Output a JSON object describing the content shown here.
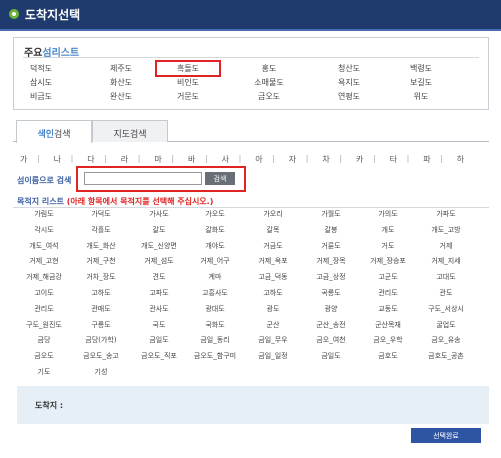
{
  "window": {
    "title": "도착지선택"
  },
  "major": {
    "title_prefix": "주요",
    "title_suffix": "섬리스트",
    "islands": [
      "덕적도",
      "제주도",
      "흑돌도",
      "홍도",
      "청산도",
      "백령도",
      "삼시도",
      "화산도",
      "비인도",
      "소매물도",
      "욕지도",
      "보길도",
      "비금도",
      "완산도",
      "거문도",
      "금오도",
      "연평도",
      "위도"
    ],
    "selected_index": 2
  },
  "tabs": [
    {
      "prefix": "색인",
      "suffix": "검색",
      "active": true
    },
    {
      "prefix": "",
      "suffix": "지도검색",
      "active": false
    }
  ],
  "alphabet": [
    "가",
    "나",
    "다",
    "라",
    "마",
    "바",
    "사",
    "아",
    "자",
    "차",
    "카",
    "타",
    "파",
    "하"
  ],
  "search": {
    "label": "섬이름으로 검색",
    "value": "",
    "placeholder": "",
    "button": "검색"
  },
  "dest_list": {
    "title": "목적지 리스트",
    "note": "(아래 항목에서 목적지를 선택해 주십시오.)",
    "items": [
      "가림도",
      "가덕도",
      "가사도",
      "가오도",
      "가오리",
      "가월도",
      "가의도",
      "가파도",
      "각시도",
      "각흘도",
      "갈도",
      "갈화도",
      "갈목",
      "갈봉",
      "개도",
      "개도_고방",
      "개도_여석",
      "개도_화산",
      "개도_신양면",
      "개야도",
      "거금도",
      "거륜도",
      "거도",
      "거제",
      "거제_고현",
      "거제_구천",
      "거제_섬도",
      "거제_어구",
      "거제_옥포",
      "거제_장목",
      "거제_장승포",
      "거제_지세",
      "거제_해금강",
      "거차_장도",
      "견도",
      "계마",
      "고금_덕동",
      "고금_상정",
      "고군도",
      "고대도",
      "고이도",
      "고하도",
      "고파도",
      "고흥사도",
      "고하도",
      "곡룡도",
      "관리도",
      "관도",
      "관리도",
      "관매도",
      "관사도",
      "광대도",
      "광도",
      "광양",
      "교동도",
      "구도_서상시",
      "구도_원진도",
      "구룡도",
      "국도",
      "국화도",
      "군산",
      "군산_송전",
      "군산목재",
      "굴업도",
      "금당",
      "금당(가학)",
      "금일도",
      "금일_동리",
      "금일_무우",
      "금오_여천",
      "금오_우학",
      "금오_유송",
      "금오도",
      "금오도_송고",
      "금오도_직포",
      "금오도_함구미",
      "금일_일정",
      "금일도",
      "금호도",
      "금호도_공촌",
      "기도",
      "기성"
    ]
  },
  "arrival": {
    "label": "도착지 :"
  },
  "confirm_button": "선택완료",
  "colors": {
    "titlebar": "#1f3b6e",
    "accent": "#4a86c8",
    "highlight": "#e02424",
    "button": "#2e55a4"
  }
}
